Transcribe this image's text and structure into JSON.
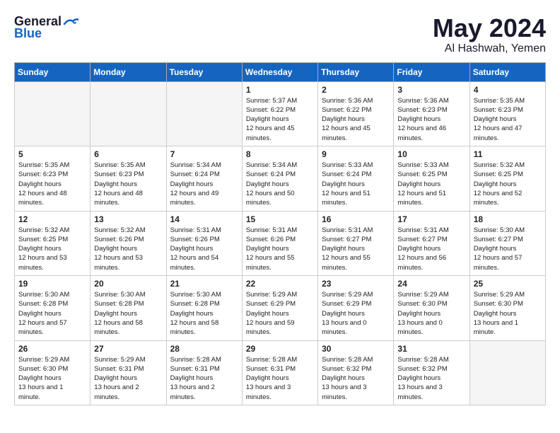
{
  "header": {
    "logo_general": "General",
    "logo_blue": "Blue",
    "month": "May 2024",
    "location": "Al Hashwah, Yemen"
  },
  "weekdays": [
    "Sunday",
    "Monday",
    "Tuesday",
    "Wednesday",
    "Thursday",
    "Friday",
    "Saturday"
  ],
  "weeks": [
    [
      {
        "day": "",
        "empty": true
      },
      {
        "day": "",
        "empty": true
      },
      {
        "day": "",
        "empty": true
      },
      {
        "day": "1",
        "sunrise": "5:37 AM",
        "sunset": "6:22 PM",
        "daylight": "12 hours and 45 minutes."
      },
      {
        "day": "2",
        "sunrise": "5:36 AM",
        "sunset": "6:22 PM",
        "daylight": "12 hours and 45 minutes."
      },
      {
        "day": "3",
        "sunrise": "5:36 AM",
        "sunset": "6:23 PM",
        "daylight": "12 hours and 46 minutes."
      },
      {
        "day": "4",
        "sunrise": "5:35 AM",
        "sunset": "6:23 PM",
        "daylight": "12 hours and 47 minutes."
      }
    ],
    [
      {
        "day": "5",
        "sunrise": "5:35 AM",
        "sunset": "6:23 PM",
        "daylight": "12 hours and 48 minutes."
      },
      {
        "day": "6",
        "sunrise": "5:35 AM",
        "sunset": "6:23 PM",
        "daylight": "12 hours and 48 minutes."
      },
      {
        "day": "7",
        "sunrise": "5:34 AM",
        "sunset": "6:24 PM",
        "daylight": "12 hours and 49 minutes."
      },
      {
        "day": "8",
        "sunrise": "5:34 AM",
        "sunset": "6:24 PM",
        "daylight": "12 hours and 50 minutes."
      },
      {
        "day": "9",
        "sunrise": "5:33 AM",
        "sunset": "6:24 PM",
        "daylight": "12 hours and 51 minutes."
      },
      {
        "day": "10",
        "sunrise": "5:33 AM",
        "sunset": "6:25 PM",
        "daylight": "12 hours and 51 minutes."
      },
      {
        "day": "11",
        "sunrise": "5:32 AM",
        "sunset": "6:25 PM",
        "daylight": "12 hours and 52 minutes."
      }
    ],
    [
      {
        "day": "12",
        "sunrise": "5:32 AM",
        "sunset": "6:25 PM",
        "daylight": "12 hours and 53 minutes."
      },
      {
        "day": "13",
        "sunrise": "5:32 AM",
        "sunset": "6:26 PM",
        "daylight": "12 hours and 53 minutes."
      },
      {
        "day": "14",
        "sunrise": "5:31 AM",
        "sunset": "6:26 PM",
        "daylight": "12 hours and 54 minutes."
      },
      {
        "day": "15",
        "sunrise": "5:31 AM",
        "sunset": "6:26 PM",
        "daylight": "12 hours and 55 minutes."
      },
      {
        "day": "16",
        "sunrise": "5:31 AM",
        "sunset": "6:27 PM",
        "daylight": "12 hours and 55 minutes."
      },
      {
        "day": "17",
        "sunrise": "5:31 AM",
        "sunset": "6:27 PM",
        "daylight": "12 hours and 56 minutes."
      },
      {
        "day": "18",
        "sunrise": "5:30 AM",
        "sunset": "6:27 PM",
        "daylight": "12 hours and 57 minutes."
      }
    ],
    [
      {
        "day": "19",
        "sunrise": "5:30 AM",
        "sunset": "6:28 PM",
        "daylight": "12 hours and 57 minutes."
      },
      {
        "day": "20",
        "sunrise": "5:30 AM",
        "sunset": "6:28 PM",
        "daylight": "12 hours and 58 minutes."
      },
      {
        "day": "21",
        "sunrise": "5:30 AM",
        "sunset": "6:28 PM",
        "daylight": "12 hours and 58 minutes."
      },
      {
        "day": "22",
        "sunrise": "5:29 AM",
        "sunset": "6:29 PM",
        "daylight": "12 hours and 59 minutes."
      },
      {
        "day": "23",
        "sunrise": "5:29 AM",
        "sunset": "6:29 PM",
        "daylight": "13 hours and 0 minutes."
      },
      {
        "day": "24",
        "sunrise": "5:29 AM",
        "sunset": "6:30 PM",
        "daylight": "13 hours and 0 minutes."
      },
      {
        "day": "25",
        "sunrise": "5:29 AM",
        "sunset": "6:30 PM",
        "daylight": "13 hours and 1 minute."
      }
    ],
    [
      {
        "day": "26",
        "sunrise": "5:29 AM",
        "sunset": "6:30 PM",
        "daylight": "13 hours and 1 minute."
      },
      {
        "day": "27",
        "sunrise": "5:29 AM",
        "sunset": "6:31 PM",
        "daylight": "13 hours and 2 minutes."
      },
      {
        "day": "28",
        "sunrise": "5:28 AM",
        "sunset": "6:31 PM",
        "daylight": "13 hours and 2 minutes."
      },
      {
        "day": "29",
        "sunrise": "5:28 AM",
        "sunset": "6:31 PM",
        "daylight": "13 hours and 3 minutes."
      },
      {
        "day": "30",
        "sunrise": "5:28 AM",
        "sunset": "6:32 PM",
        "daylight": "13 hours and 3 minutes."
      },
      {
        "day": "31",
        "sunrise": "5:28 AM",
        "sunset": "6:32 PM",
        "daylight": "13 hours and 3 minutes."
      },
      {
        "day": "",
        "empty": true,
        "shaded": true
      }
    ]
  ]
}
